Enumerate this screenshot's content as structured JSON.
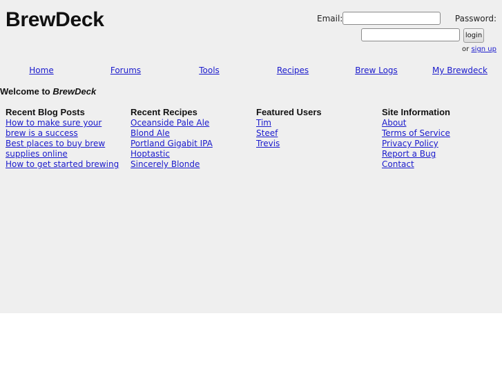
{
  "header": {
    "logo": "BrewDeck",
    "login": {
      "email_label": "Email:",
      "password_label": "Password:",
      "email_value": "",
      "password_value": "",
      "login_button": "login",
      "or_text": "or",
      "signup_link": "sign up"
    }
  },
  "nav": {
    "items": [
      "Home",
      "Forums",
      "Tools",
      "Recipes",
      "Brew Logs",
      "My Brewdeck"
    ]
  },
  "welcome": {
    "prefix": "Welcome to",
    "brand": "BrewDeck"
  },
  "sections": {
    "blog": {
      "title": "Recent Blog Posts",
      "items": [
        "How to make sure your brew is a success",
        "Best places to buy brew supplies online",
        "How to get started brewing"
      ]
    },
    "recipes": {
      "title": "Recent Recipes",
      "items": [
        "Oceanside Pale Ale",
        "Blond Ale",
        "Portland Gigabit IPA",
        "Hoptastic",
        "Sincerely Blonde"
      ]
    },
    "users": {
      "title": "Featured Users",
      "items": [
        "Tim",
        "Steef",
        "Trevis"
      ]
    },
    "site_info": {
      "title": "Site Information",
      "items": [
        "About",
        "Terms of Service",
        "Privacy Policy",
        "Report a Bug",
        "Contact"
      ]
    }
  }
}
